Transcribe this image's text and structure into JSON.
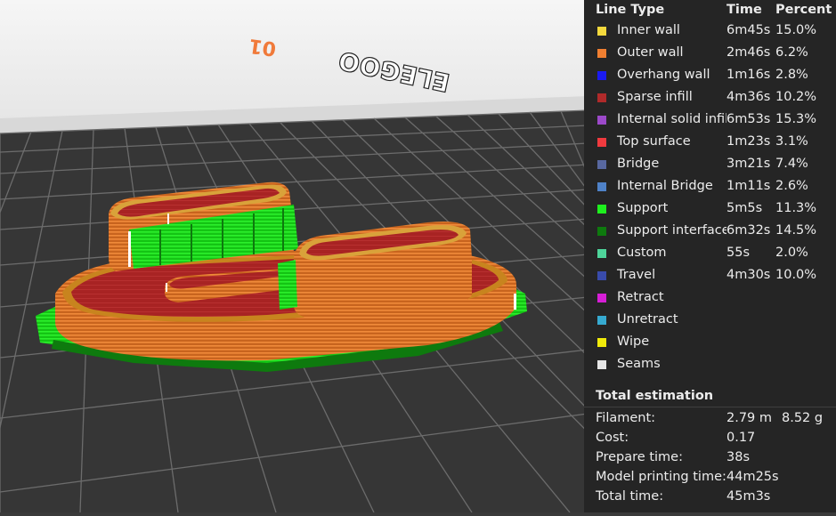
{
  "plate_labels": {
    "model_number": "01",
    "brand_text": "ELEGOO"
  },
  "legend": {
    "headers": {
      "line_type": "Line Type",
      "time": "Time",
      "percent": "Percent"
    },
    "items": [
      {
        "label": "Inner wall",
        "time": "6m45s",
        "percent": "15.0%",
        "color": "#f4d93d"
      },
      {
        "label": "Outer wall",
        "time": "2m46s",
        "percent": "6.2%",
        "color": "#f07f31"
      },
      {
        "label": "Overhang wall",
        "time": "1m16s",
        "percent": "2.8%",
        "color": "#1a1af0"
      },
      {
        "label": "Sparse infill",
        "time": "4m36s",
        "percent": "10.2%",
        "color": "#b02a2a"
      },
      {
        "label": "Internal solid infill",
        "time": "6m53s",
        "percent": "15.3%",
        "color": "#9c49c9"
      },
      {
        "label": "Top surface",
        "time": "1m23s",
        "percent": "3.1%",
        "color": "#f03a3e"
      },
      {
        "label": "Bridge",
        "time": "3m21s",
        "percent": "7.4%",
        "color": "#5868a0"
      },
      {
        "label": "Internal Bridge",
        "time": "1m11s",
        "percent": "2.6%",
        "color": "#4f82c8"
      },
      {
        "label": "Support",
        "time": "5m5s",
        "percent": "11.3%",
        "color": "#1ef01e"
      },
      {
        "label": "Support interface",
        "time": "6m32s",
        "percent": "14.5%",
        "color": "#0e7a0e"
      },
      {
        "label": "Custom",
        "time": "55s",
        "percent": "2.0%",
        "color": "#4ed49a"
      },
      {
        "label": "Travel",
        "time": "4m30s",
        "percent": "10.0%",
        "color": "#394bab"
      },
      {
        "label": "Retract",
        "time": "",
        "percent": "",
        "color": "#d61ed6"
      },
      {
        "label": "Unretract",
        "time": "",
        "percent": "",
        "color": "#36aad0"
      },
      {
        "label": "Wipe",
        "time": "",
        "percent": "",
        "color": "#f0ea0a"
      },
      {
        "label": "Seams",
        "time": "",
        "percent": "",
        "color": "#e6e6e6"
      }
    ]
  },
  "total": {
    "title": "Total estimation",
    "rows": [
      {
        "label": "Filament:",
        "value": "2.79 m",
        "value2": "8.52 g"
      },
      {
        "label": "Cost:",
        "value": "0.17",
        "value2": ""
      },
      {
        "label": "Prepare time:",
        "value": "38s",
        "value2": ""
      },
      {
        "label": "Model printing time:",
        "value": "44m25s",
        "value2": ""
      },
      {
        "label": "Total time:",
        "value": "45m3s",
        "value2": ""
      }
    ]
  }
}
